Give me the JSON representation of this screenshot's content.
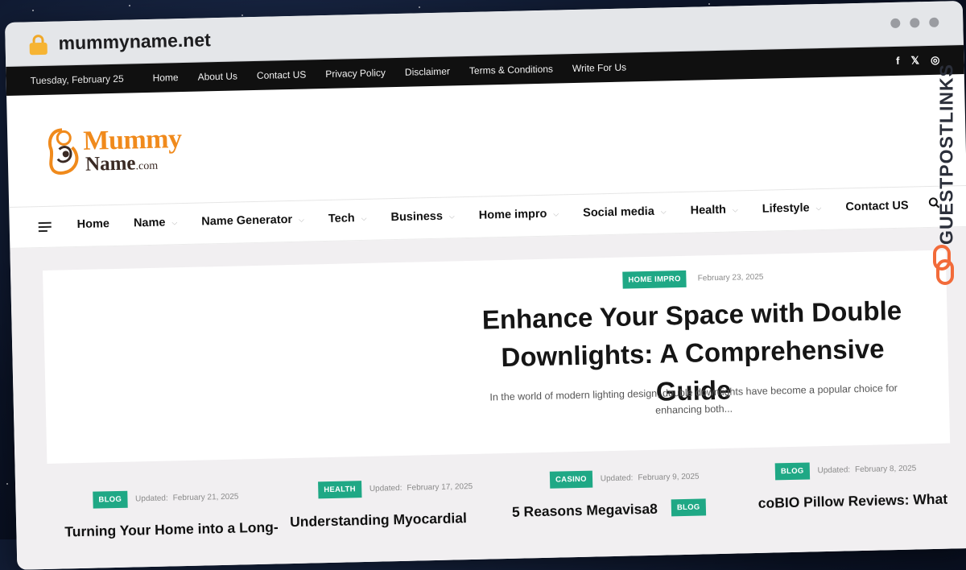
{
  "browser": {
    "url": "mummyname.net"
  },
  "topbar": {
    "date": "Tuesday, February 25",
    "links": [
      "Home",
      "About Us",
      "Contact US",
      "Privacy Policy",
      "Disclaimer",
      "Terms & Conditions",
      "Write For Us"
    ],
    "social": [
      "f",
      "𝕏",
      "◎"
    ]
  },
  "logo": {
    "line1": "Mummy",
    "line2": "Name",
    "suffix": ".com"
  },
  "mainnav": {
    "items": [
      {
        "label": "Home",
        "dropdown": false
      },
      {
        "label": "Name",
        "dropdown": true
      },
      {
        "label": "Name Generator",
        "dropdown": true
      },
      {
        "label": "Tech",
        "dropdown": true
      },
      {
        "label": "Business",
        "dropdown": true
      },
      {
        "label": "Home impro",
        "dropdown": true
      },
      {
        "label": "Social media",
        "dropdown": true
      },
      {
        "label": "Health",
        "dropdown": true
      },
      {
        "label": "Lifestyle",
        "dropdown": true
      },
      {
        "label": "Contact US",
        "dropdown": false
      }
    ]
  },
  "hero": {
    "category": "HOME IMPRO",
    "date": "February 23, 2025",
    "title": "Enhance Your Space with Double Downlights: A Comprehensive Guide",
    "excerpt": "In the world of modern lighting design, double downlights have become a popular choice for enhancing both..."
  },
  "cards": [
    {
      "category": "BLOG",
      "updated_label": "Updated:",
      "date": "February 21, 2025",
      "title": "Turning Your Home into a Long-"
    },
    {
      "category": "HEALTH",
      "updated_label": "Updated:",
      "date": "February 17, 2025",
      "title": "Understanding Myocardial"
    },
    {
      "category": "CASINO",
      "updated_label": "Updated:",
      "date": "February 9, 2025",
      "title": "5 Reasons Megavisa8      ot",
      "overlay_badge": "BLOG"
    },
    {
      "category": "BLOG",
      "updated_label": "Updated:",
      "date": "February 8, 2025",
      "title": "coBIO Pillow Reviews: What"
    }
  ],
  "watermark": {
    "text": "GUESTPOSTLINKS"
  },
  "colors": {
    "accent": "#1fa885",
    "logo_orange": "#f08a1c",
    "topbar": "#101010"
  }
}
